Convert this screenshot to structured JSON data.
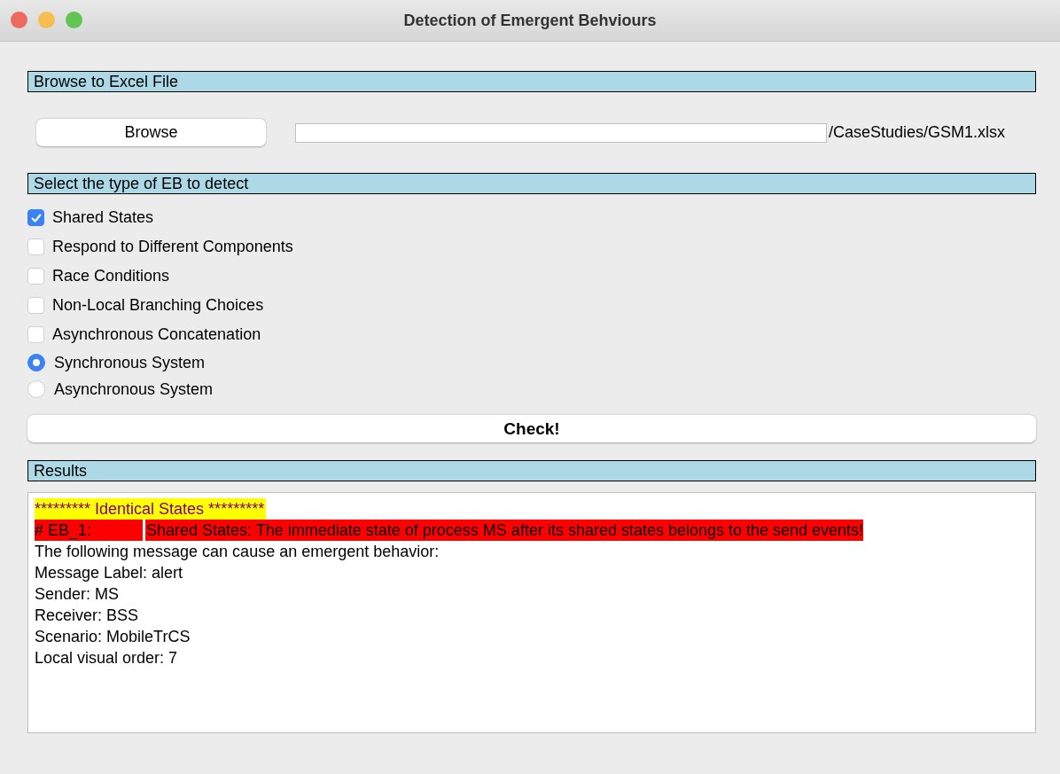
{
  "window": {
    "title": "Detection of Emergent Behviours"
  },
  "file_section": {
    "heading": "Browse to Excel File",
    "browse_button": "Browse",
    "path": "/CaseStudies/GSM1.xlsx"
  },
  "eb_section": {
    "heading": "Select the type of EB to detect",
    "options": [
      {
        "kind": "checkbox",
        "label": "Shared States",
        "checked": true
      },
      {
        "kind": "checkbox",
        "label": "Respond to Different Components",
        "checked": false
      },
      {
        "kind": "checkbox",
        "label": "Race Conditions",
        "checked": false
      },
      {
        "kind": "checkbox",
        "label": "Non-Local Branching Choices",
        "checked": false
      },
      {
        "kind": "checkbox",
        "label": "Asynchronous Concatenation",
        "checked": false
      },
      {
        "kind": "radio",
        "label": "Synchronous System",
        "selected": true
      },
      {
        "kind": "radio",
        "label": "Asynchronous System",
        "selected": false
      }
    ]
  },
  "check_button": "Check!",
  "results": {
    "heading": "Results",
    "lines": [
      {
        "kind": "banner",
        "text": "********* Identical States *********"
      },
      {
        "kind": "alert",
        "id": "# EB_1:",
        "text": "Shared States: The immediate state of process MS after its shared states belongs to the send events!"
      },
      {
        "kind": "plain",
        "text": "The following message can cause an emergent behavior:"
      },
      {
        "kind": "plain",
        "text": "Message Label: alert"
      },
      {
        "kind": "plain",
        "text": "Sender: MS"
      },
      {
        "kind": "plain",
        "text": "Receiver: BSS"
      },
      {
        "kind": "plain",
        "text": "Scenario: MobileTrCS"
      },
      {
        "kind": "plain",
        "text": "Local visual order: 7"
      }
    ]
  }
}
